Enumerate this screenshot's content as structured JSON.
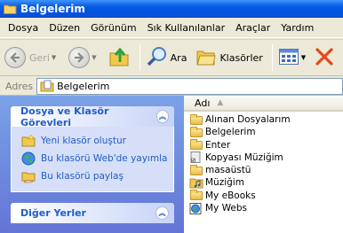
{
  "window": {
    "title": "Belgelerim"
  },
  "menu": [
    "Dosya",
    "Düzen",
    "Görünüm",
    "Sık Kullanılanlar",
    "Araçlar",
    "Yardım"
  ],
  "toolbar": {
    "back_label": "Geri",
    "search_label": "Ara",
    "folders_label": "Klasörler"
  },
  "address": {
    "label": "Adres",
    "value": "Belgelerim"
  },
  "tasks_panel": {
    "title": "Dosya ve Klasör Görevleri",
    "items": [
      "Yeni klasör oluştur",
      "Bu klasörü Web'de yayımla",
      "Bu klasörü paylaş"
    ]
  },
  "places_panel": {
    "title": "Diğer Yerler"
  },
  "file_list": {
    "column": "Adı",
    "items": [
      "Alınan Dosyalarım",
      "Belgelerim",
      "Enter",
      "Kopyası Müziğim",
      "masaüstü",
      "Müziğim",
      "My eBooks",
      "My Webs"
    ]
  },
  "colors": {
    "titlebar": "#0054e3",
    "task_link": "#215dc6",
    "panel_bg": "#d6dff7",
    "close_x": "#e04a1c"
  }
}
